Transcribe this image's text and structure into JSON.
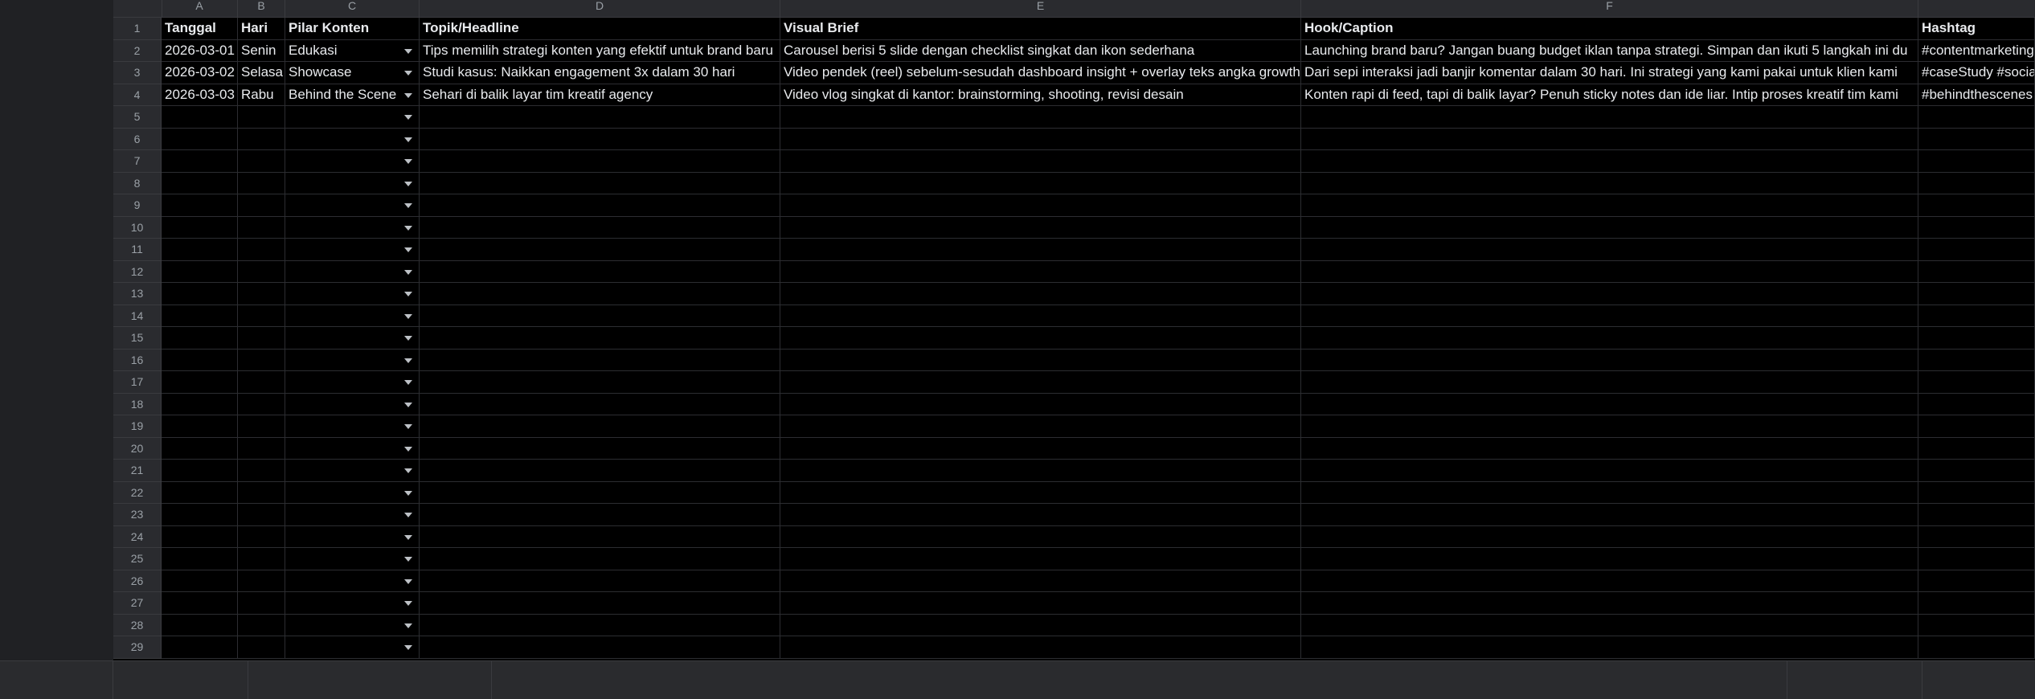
{
  "columns": [
    "A",
    "B",
    "C",
    "D",
    "E",
    "F"
  ],
  "header_row": [
    "Tanggal",
    "Hari",
    "Pilar Konten",
    "Topik/Headline",
    "Visual Brief",
    "Hook/Caption",
    "Hashtag"
  ],
  "data_rows": [
    [
      "2026-03-01",
      "Senin",
      "Edukasi",
      "Tips memilih strategi konten yang efektif untuk brand baru",
      "Carousel berisi 5 slide dengan checklist singkat dan ikon sederhana",
      "Launching brand baru? Jangan buang budget iklan tanpa strategi. Simpan dan ikuti 5 langkah ini du",
      "#contentmarketing"
    ],
    [
      "2026-03-02",
      "Selasa",
      "Showcase",
      "Studi kasus: Naikkan engagement 3x dalam 30 hari",
      "Video pendek (reel) sebelum-sesudah dashboard insight + overlay teks angka growth",
      "Dari sepi interaksi jadi banjir komentar dalam 30 hari. Ini strategi yang kami pakai untuk klien kami",
      "#caseStudy #social"
    ],
    [
      "2026-03-03",
      "Rabu",
      "Behind the Scene",
      "Sehari di balik layar tim kreatif agency",
      "Video vlog singkat di kantor: brainstorming, shooting, revisi desain",
      "Konten rapi di feed, tapi di balik layar? Penuh sticky notes dan ide liar. Intip proses kreatif tim kami",
      "#behindthescenes"
    ]
  ],
  "row_numbers": [
    "1",
    "2",
    "3",
    "4",
    "5",
    "6",
    "7",
    "8",
    "9",
    "10",
    "11",
    "12",
    "13",
    "14",
    "15",
    "16",
    "17",
    "18",
    "19",
    "20",
    "21",
    "22",
    "23",
    "24",
    "25",
    "26",
    "27",
    "28",
    "29"
  ],
  "dropdown_icon": "chevron-down-icon"
}
